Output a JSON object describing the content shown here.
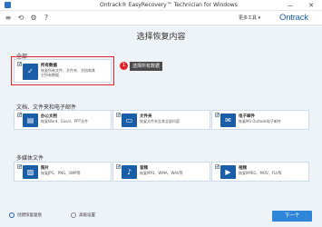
{
  "window": {
    "title": "Ontrack® EasyRecovery™ Technician for Windows",
    "minimize": "—",
    "close": "✕"
  },
  "toolbar": {
    "tools_menu": "更多工具 ▾",
    "brand": "Ontrack"
  },
  "page": {
    "title": "选择恢复内容"
  },
  "sections": {
    "all": {
      "label": "全部"
    },
    "docs": {
      "label": "文档、文件夹和电子邮件"
    },
    "media": {
      "label": "多媒体文件"
    }
  },
  "cards": {
    "all_data": {
      "title": "所有数据",
      "desc1": "恢复所有文件、文件夹、文档和其",
      "desc2": "它所有数据",
      "checked": "✔"
    },
    "office": {
      "title": "办公文档",
      "desc": "恢复Word、Excel、PPT文件",
      "checked": "✔"
    },
    "folder": {
      "title": "文件夹",
      "desc": "恢复文件夹及其全部内容",
      "checked": "✔"
    },
    "email": {
      "title": "电子邮件",
      "desc": "恢复MS Outlook电子邮件",
      "checked": "✔"
    },
    "photo": {
      "title": "照片",
      "desc": "恢复JPG、PNG、BMP等",
      "checked": "✔"
    },
    "audio": {
      "title": "音频",
      "desc": "恢复MP3、WMA、WAV等",
      "checked": "✔"
    },
    "video": {
      "title": "视频",
      "desc": "恢复MPEG、MOV、FLV等",
      "checked": "✔"
    }
  },
  "callout": {
    "number": "1",
    "text": "选择所有数据"
  },
  "footer": {
    "create_disk": "创建恢复驱盘",
    "link2": "高级设置",
    "next": "下一个"
  },
  "colors": {
    "accent": "#1a5ea8",
    "highlight": "#e0242a",
    "button": "#2f86d8"
  }
}
